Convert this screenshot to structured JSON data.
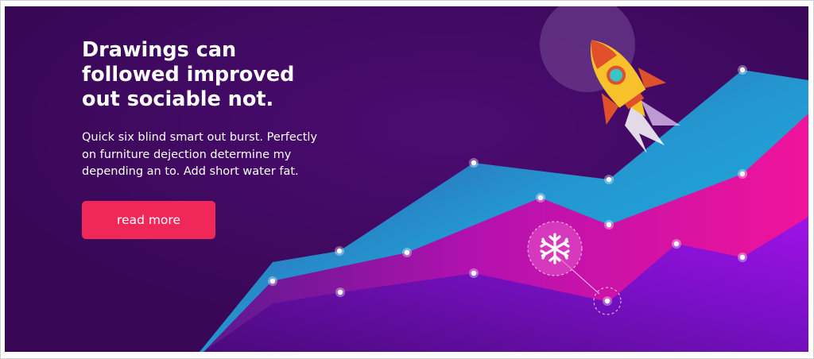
{
  "hero": {
    "headline_lines": [
      "Drawings can",
      "followed improved",
      "out sociable not."
    ],
    "description_lines": [
      "Quick six blind smart out burst. Perfectly",
      "on furniture dejection determine my",
      "depending an to. Add short water fat."
    ],
    "cta_label": "read more"
  },
  "illustration": {
    "icons": [
      "rocket-icon",
      "snowflake-icon"
    ]
  },
  "colors": {
    "background": "#3a0a5a",
    "cta": "#f0285a",
    "layer_back": "#1fa9e3",
    "layer_middle": "#d010a8",
    "layer_front": "#8a10d8",
    "rocket_body": "#f6c12a",
    "rocket_fins": "#e0502a"
  }
}
